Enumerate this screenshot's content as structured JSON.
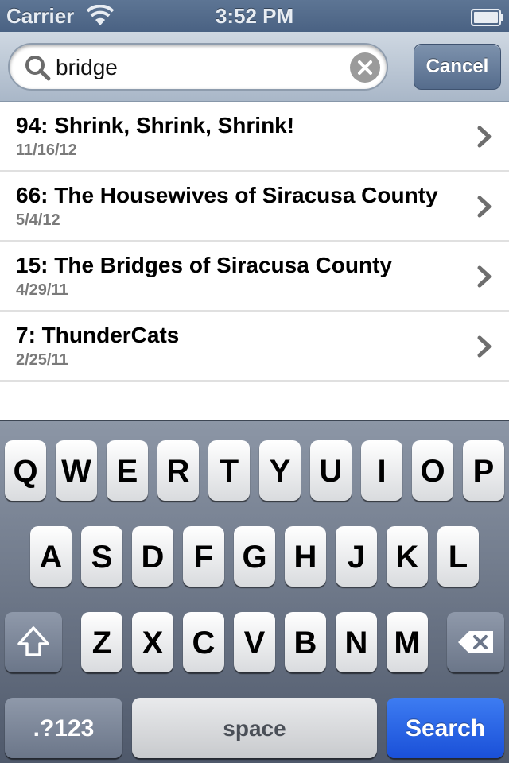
{
  "status_bar": {
    "carrier": "Carrier",
    "time": "3:52 PM",
    "icons": [
      "wifi-icon",
      "battery-icon"
    ]
  },
  "search": {
    "query": "bridge",
    "cancel_label": "Cancel",
    "icons": [
      "search-icon",
      "clear-icon"
    ]
  },
  "results": [
    {
      "title": "94: Shrink, Shrink, Shrink!",
      "date": "11/16/12"
    },
    {
      "title": "66: The Housewives of Siracusa County",
      "date": "5/4/12"
    },
    {
      "title": "15: The Bridges of Siracusa County",
      "date": "4/29/11"
    },
    {
      "title": "7: ThunderCats",
      "date": "2/25/11"
    }
  ],
  "keyboard": {
    "row1": [
      "Q",
      "W",
      "E",
      "R",
      "T",
      "Y",
      "U",
      "I",
      "O",
      "P"
    ],
    "row2": [
      "A",
      "S",
      "D",
      "F",
      "G",
      "H",
      "J",
      "K",
      "L"
    ],
    "row3": [
      "Z",
      "X",
      "C",
      "V",
      "B",
      "N",
      "M"
    ],
    "numbers_label": ".?123",
    "space_label": "space",
    "search_label": "Search",
    "icons": [
      "shift-icon",
      "backspace-icon"
    ]
  },
  "colors": {
    "search_key": "#1a50d8",
    "status_bar": "#4a6283",
    "keyboard_bg": "#4f596b"
  }
}
